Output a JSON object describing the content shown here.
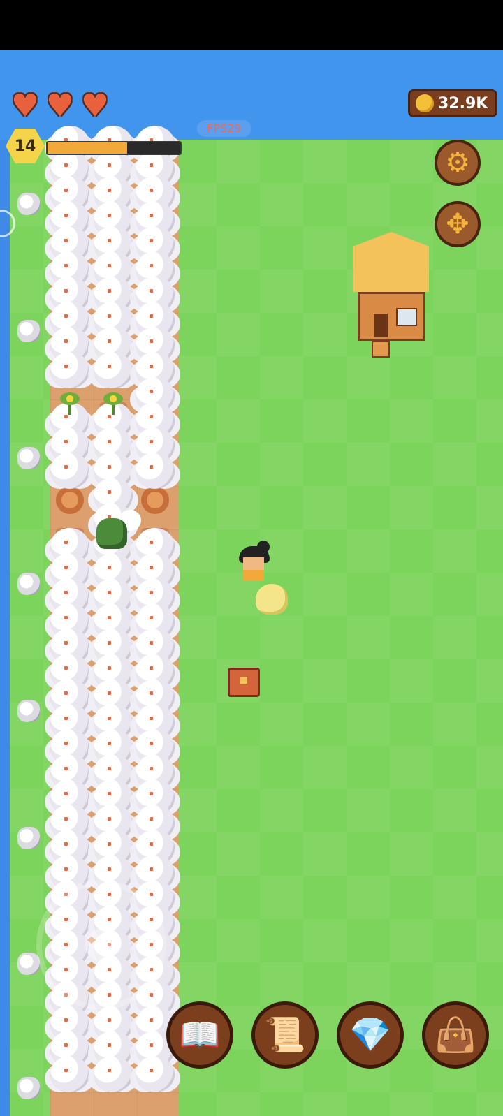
{
  "hud": {
    "hearts": [
      "heart-full",
      "heart-full",
      "heart-full"
    ],
    "level": "14",
    "xp_progress": 0.6,
    "fps_label": "FPS29",
    "coins": "32.9K"
  },
  "buttons": {
    "settings_icon": "gear-icon",
    "move_icon": "move-arrows-icon"
  },
  "bottom_menu": [
    {
      "name": "journal-book",
      "icon": "book-icon",
      "glyph": "📖"
    },
    {
      "name": "quest-scroll",
      "icon": "scroll-icon",
      "glyph": "📜"
    },
    {
      "name": "gem-shop",
      "icon": "diamond-icon",
      "glyph": "💎"
    },
    {
      "name": "inventory-bag",
      "icon": "bag-icon",
      "glyph": "👜"
    }
  ],
  "colors": {
    "sky": "#4295ec",
    "grass": "#7dd45c",
    "dirt": "#dca06e",
    "heart": "#e8603c",
    "level_badge": "#f4d44a",
    "xp_fill": "#f3a93a",
    "coin_panel": "#7a3e1f"
  }
}
